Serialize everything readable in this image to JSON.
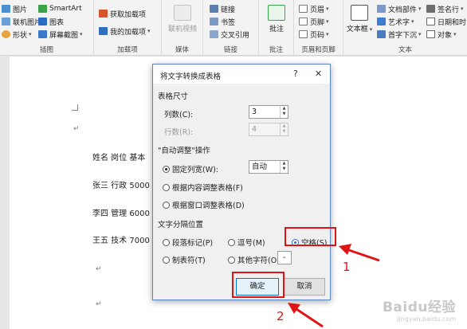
{
  "ribbon": {
    "groups": {
      "illustrations": {
        "label": "插图",
        "items": [
          "图片",
          "联机图片",
          "形状",
          "SmartArt",
          "图表",
          "屏幕截图"
        ]
      },
      "addins": {
        "label": "加载项",
        "items": [
          "获取加载项",
          "我的加载项"
        ]
      },
      "media": {
        "label": "媒体",
        "online_video": "联机视频"
      },
      "links": {
        "label": "链接",
        "items": [
          "链接",
          "书签",
          "交叉引用"
        ]
      },
      "comments": {
        "label": "批注",
        "comment": "批注"
      },
      "header_footer": {
        "label": "页眉和页脚",
        "items": [
          "页眉",
          "页脚",
          "页码"
        ]
      },
      "text": {
        "label": "文本",
        "textbox": "文本框",
        "items": [
          "文档部件",
          "艺术字",
          "首字下沉",
          "签名行",
          "日期和时",
          "对象"
        ]
      }
    }
  },
  "document": {
    "lines": [
      {
        "text": "姓名 岗位 基本"
      },
      {
        "text": "张三 行政 5000"
      },
      {
        "text": "李四 管理 6000"
      },
      {
        "text": "王五 技术 7000"
      }
    ],
    "para_mark": "↵"
  },
  "dialog": {
    "title": "将文字转换成表格",
    "help": "?",
    "close": "✕",
    "size_section": "表格尺寸",
    "columns_label": "列数(C):",
    "columns_value": "3",
    "rows_label": "行数(R):",
    "rows_value": "4",
    "autofit_section": "\"自动调整\"操作",
    "fixed_width_label": "固定列宽(W):",
    "fixed_width_value": "自动",
    "autofit_content": "根据内容调整表格(F)",
    "autofit_window": "根据窗口调整表格(D)",
    "separator_section": "文字分隔位置",
    "sep_paragraph": "段落标记(P)",
    "sep_comma": "逗号(M)",
    "sep_space": "空格(S)",
    "sep_tab": "制表符(T)",
    "sep_other": "其他字符(O):",
    "sep_other_value": "-",
    "ok": "确定",
    "cancel": "取消"
  },
  "annotations": {
    "step1": "1",
    "step2": "2"
  },
  "watermark": {
    "brand": "Baidu经验",
    "sub": "jingyan.baidu.com"
  },
  "colors": {
    "accent_red": "#e01414",
    "dialog_border": "#5b86c4",
    "ok_border": "#0078d7"
  }
}
